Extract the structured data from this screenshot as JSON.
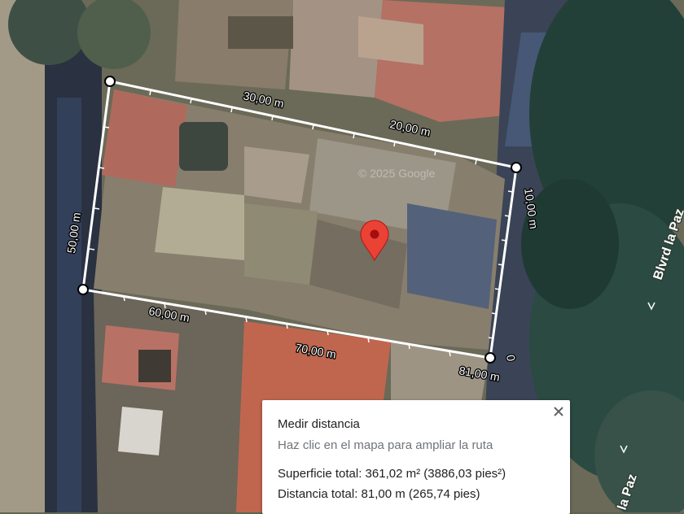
{
  "map": {
    "watermark": "© 2025 Google",
    "road_label_1": "Blvrd la Paz",
    "road_label_2": "la Paz",
    "marker_icon": "red-location-pin-icon"
  },
  "ruler": {
    "labels": [
      "30,00 m",
      "20,00 m",
      "10,00 m",
      "0",
      "81,00 m",
      "70,00 m",
      "60,00 m",
      "50,00 m"
    ]
  },
  "panel": {
    "title": "Medir distancia",
    "subtitle": "Haz clic en el mapa para ampliar la ruta",
    "area": "Superficie total: 361,02 m² (3886,03 pies²)",
    "distance": "Distancia total: 81,00 m (265,74 pies)",
    "close_icon": "close-icon"
  },
  "colors": {
    "ruler_line": "#ffffff",
    "marker": "#ea4335",
    "panel_bg": "#ffffff",
    "secondary_text": "#70757a"
  }
}
